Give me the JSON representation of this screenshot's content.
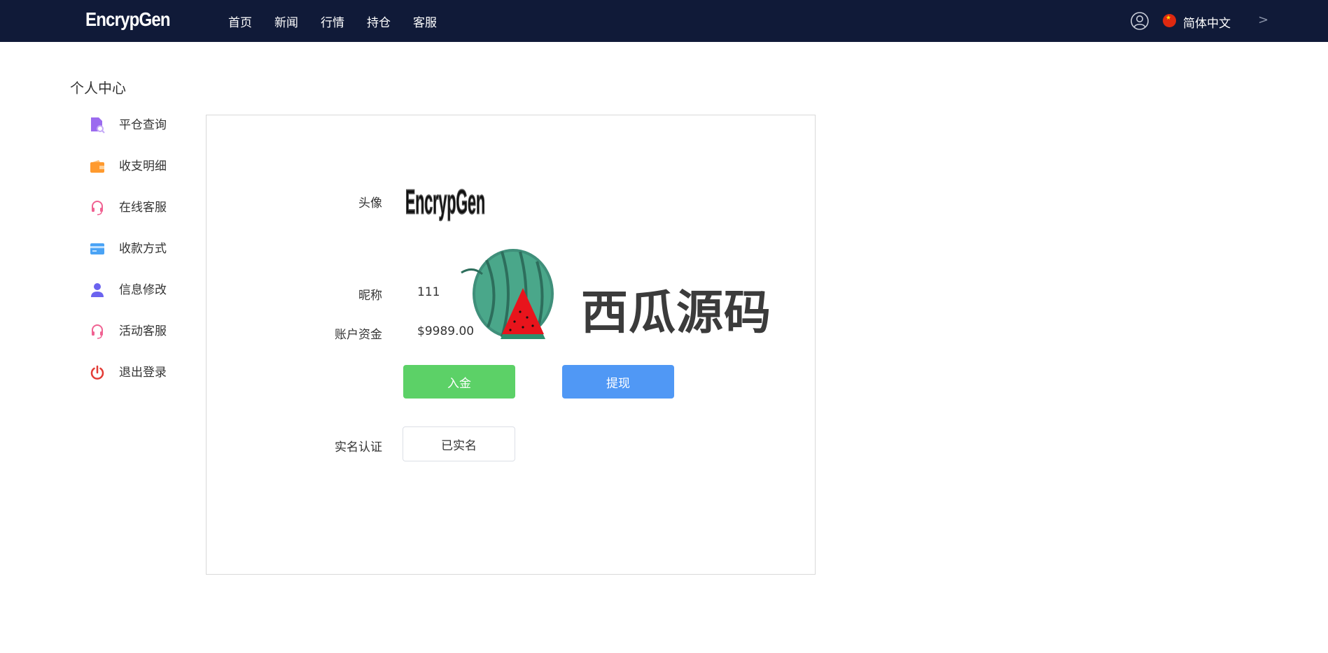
{
  "header": {
    "brand": "EncrypGen",
    "nav": [
      "首页",
      "新闻",
      "行情",
      "持仓",
      "客服"
    ],
    "language": "简体中文"
  },
  "page": {
    "title": "个人中心"
  },
  "sidebar": {
    "items": [
      {
        "label": "平仓查询",
        "icon": "file-search-icon",
        "color": "#9b6bef"
      },
      {
        "label": "收支明细",
        "icon": "wallet-icon",
        "color": "#ff9a2e"
      },
      {
        "label": "在线客服",
        "icon": "headset-icon",
        "color": "#f06292"
      },
      {
        "label": "收款方式",
        "icon": "card-icon",
        "color": "#4aa3f5"
      },
      {
        "label": "信息修改",
        "icon": "user-icon",
        "color": "#6b63ef"
      },
      {
        "label": "活动客服",
        "icon": "headset-icon",
        "color": "#f06292"
      },
      {
        "label": "退出登录",
        "icon": "power-icon",
        "color": "#e33c36"
      }
    ]
  },
  "profile": {
    "avatar_label": "头像",
    "avatar_text": "EncrypGen",
    "nickname_label": "昵称",
    "nickname": "111",
    "balance_label": "账户资金",
    "balance": "$9989.00",
    "deposit_button": "入金",
    "withdraw_button": "提现",
    "verify_label": "实名认证",
    "verify_status": "已实名"
  },
  "watermark": {
    "text": "西瓜源码"
  },
  "colors": {
    "header_bg": "#101a38",
    "deposit": "#5cd167",
    "withdraw": "#5098f5"
  }
}
